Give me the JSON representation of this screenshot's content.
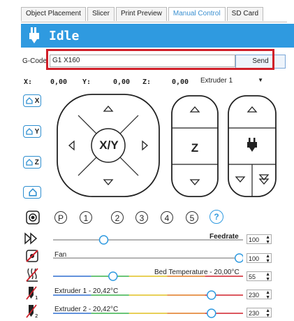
{
  "tabs": [
    "Object Placement",
    "Slicer",
    "Print Preview",
    "Manual Control",
    "SD Card"
  ],
  "active_tab": "Manual Control",
  "status": "Idle",
  "gcode": {
    "label": "G-Code:",
    "value": "G1 X160",
    "send_label": "Send"
  },
  "coords": {
    "x_label": "X:",
    "x_value": "0,00",
    "y_label": "Y:",
    "y_value": "0,00",
    "z_label": "Z:",
    "z_value": "0,00"
  },
  "extruder_select": "Extruder 1",
  "home_buttons": [
    "X",
    "Y",
    "Z"
  ],
  "jog": {
    "xy_label": "X/Y",
    "z_label": "Z"
  },
  "quick_buttons": [
    "P",
    "1",
    "2",
    "3",
    "4",
    "5",
    "?"
  ],
  "sliders": {
    "feedrate": {
      "label": "Feedrate",
      "value": "100",
      "level": 0.25
    },
    "fan": {
      "label": "Fan",
      "value": "100",
      "level": 0.98
    },
    "bed": {
      "label": "Bed Temperature - 20,00°C",
      "value": "55",
      "level": 0.3
    },
    "ext1": {
      "label": "Extruder 1 - 20,42°C",
      "value": "230",
      "level": 0.83
    },
    "ext2": {
      "label": "Extruder 2 - 20,42°C",
      "value": "230",
      "level": 0.83
    }
  },
  "colors": {
    "accent": "#2f9ae0",
    "highlight": "#d0202a"
  }
}
